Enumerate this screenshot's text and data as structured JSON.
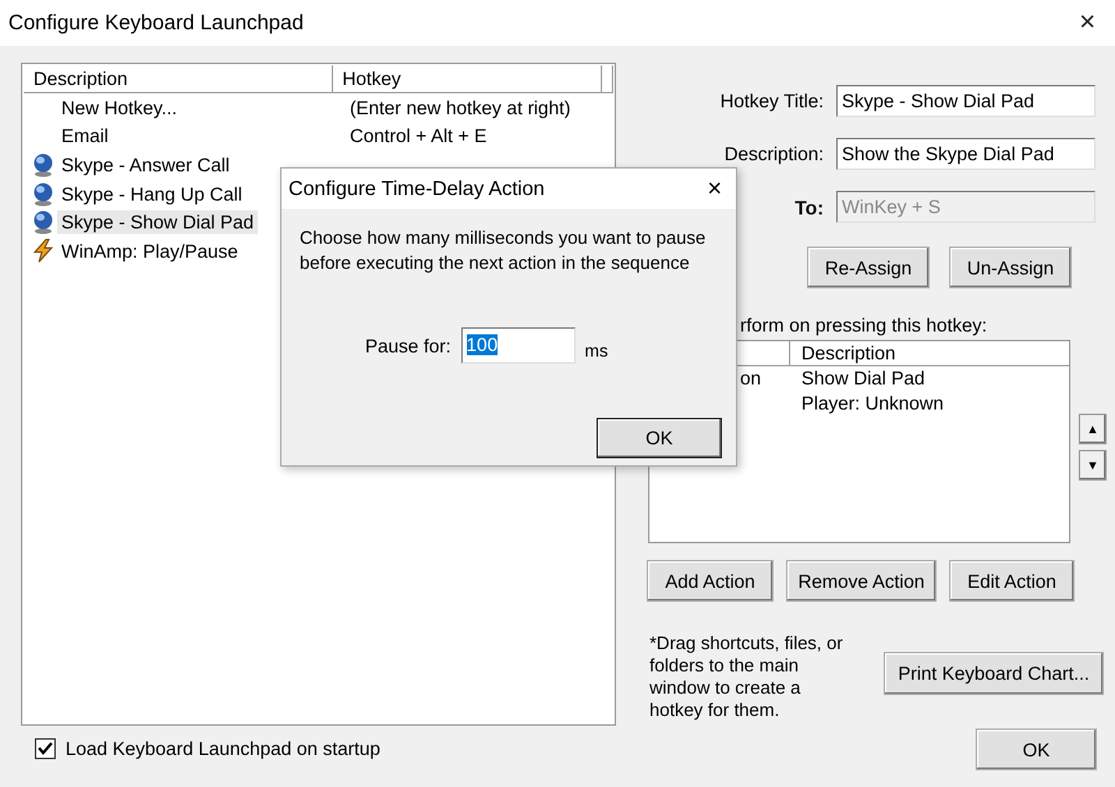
{
  "window": {
    "title": "Configure Keyboard Launchpad",
    "close": "×"
  },
  "hotkey_list": {
    "columns": [
      "Description",
      "Hotkey"
    ],
    "rows": [
      {
        "kind": "blank",
        "description": "New Hotkey...",
        "hotkey": "(Enter new hotkey at right)",
        "selected": false
      },
      {
        "kind": "blank",
        "description": "Email",
        "hotkey": "Control + Alt + E",
        "selected": false
      },
      {
        "kind": "globe",
        "description": "Skype - Answer Call",
        "selected": false
      },
      {
        "kind": "globe",
        "description": "Skype - Hang Up Call",
        "selected": false
      },
      {
        "kind": "globe",
        "description": "Skype - Show Dial Pad",
        "selected": true
      },
      {
        "kind": "bolt",
        "description": "WinAmp: Play/Pause",
        "selected": false
      }
    ]
  },
  "fields": [
    {
      "label": "Hotkey Title:",
      "value": "Skype - Show Dial Pad",
      "disabled": false
    },
    {
      "label": "Description:",
      "value": "Show the Skype Dial Pad",
      "disabled": false
    },
    {
      "label": "To:",
      "value": "WinKey + S",
      "disabled": true
    }
  ],
  "assign_buttons": [
    "Re-Assign",
    "Un-Assign"
  ],
  "actions_label": "rform on pressing this hotkey:",
  "actions_table": {
    "columns": [
      "Description"
    ],
    "rows": [
      {
        "column_1": "on",
        "description": "Show Dial Pad"
      },
      {
        "description": "Player: Unknown"
      }
    ]
  },
  "scroll_buttons": [
    "▲",
    "▼"
  ],
  "action_buttons": [
    "Add Action",
    "Remove Action",
    "Edit Action"
  ],
  "note": "*Drag shortcuts, files, or folders to the main window to create a hotkey for them.",
  "print_button": "Print Keyboard Chart...",
  "ok_button": "OK",
  "startup_checkbox": {
    "label": "Load Keyboard Launchpad on startup",
    "checked": true
  },
  "dialog": {
    "title": "Configure Time-Delay Action",
    "close": "×",
    "message": "Choose how many milliseconds you want to pause before executing the next action in the sequence",
    "pause_label": "Pause for:",
    "pause_value": "100",
    "value_selected": true,
    "unit": "ms",
    "ok": "OK"
  }
}
